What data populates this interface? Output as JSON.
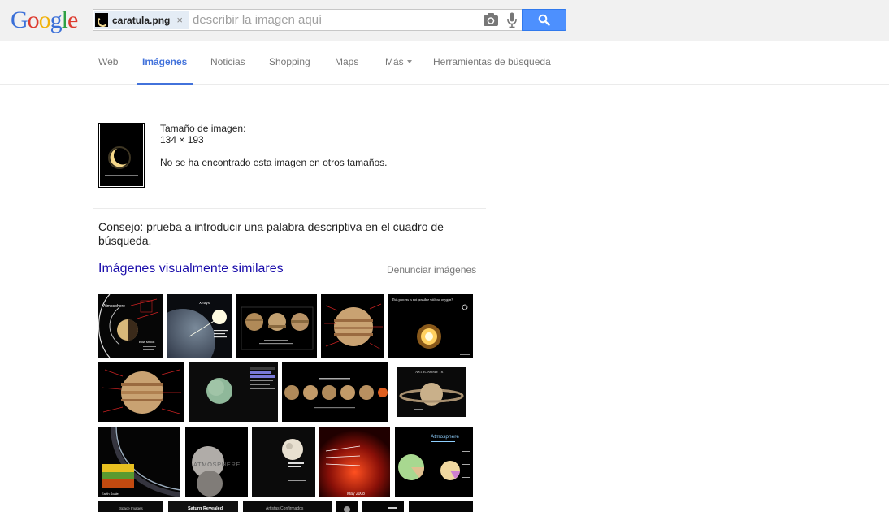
{
  "header": {
    "logo_letters": [
      {
        "ch": "G",
        "color": "#3a6fd8"
      },
      {
        "ch": "o",
        "color": "#dd3b2f"
      },
      {
        "ch": "o",
        "color": "#f1b20c"
      },
      {
        "ch": "g",
        "color": "#3a6fd8"
      },
      {
        "ch": "l",
        "color": "#2ea043"
      },
      {
        "ch": "e",
        "color": "#dd3b2f"
      }
    ],
    "image_chip": {
      "filename": "caratula.png",
      "remove": "×"
    },
    "search": {
      "placeholder": "describir la imagen aquí",
      "value": ""
    },
    "icons": {
      "camera": "camera-icon",
      "mic": "microphone-icon",
      "search": "search-icon"
    },
    "accent_color": "#4d90fe"
  },
  "nav": {
    "tabs": [
      {
        "label": "Web",
        "active": false
      },
      {
        "label": "Imágenes",
        "active": true
      },
      {
        "label": "Noticias",
        "active": false
      },
      {
        "label": "Shopping",
        "active": false
      },
      {
        "label": "Maps",
        "active": false
      },
      {
        "label": "Más",
        "active": false,
        "dropdown": true
      },
      {
        "label": "Herramientas de búsqueda",
        "active": false
      }
    ]
  },
  "result": {
    "size_label": "Tamaño de imagen:",
    "size_value": "134 × 193",
    "not_found": "No se ha encontrado esta imagen en otros tamaños.",
    "tip": "Consejo: prueba a introducir una palabra descriptiva en el cuadro de búsqueda.",
    "similar_title": "Imágenes visualmente similares",
    "report_label": "Denunciar imágenes"
  },
  "similar_images": {
    "row1": [
      {
        "kind": "atmosphere-diagram",
        "text": [
          "Atmosphere",
          "Bow shock"
        ]
      },
      {
        "kind": "planet-xray",
        "text": [
          "X-rays"
        ]
      },
      {
        "kind": "three-planets",
        "text": []
      },
      {
        "kind": "jupiter-labels",
        "text": []
      },
      {
        "kind": "explosion",
        "text": [
          "This process is not possible without oxygen?"
        ]
      }
    ],
    "row2": [
      {
        "kind": "jupiter-labels-wide",
        "text": []
      },
      {
        "kind": "green-planet",
        "text": []
      },
      {
        "kind": "five-planets",
        "text": []
      },
      {
        "kind": "saturn",
        "text": [
          "ASTRONOMY 161"
        ]
      }
    ],
    "row3": [
      {
        "kind": "limb-layers",
        "text": []
      },
      {
        "kind": "moon-atmosphere",
        "text": [
          "ATMOSPHERE"
        ]
      },
      {
        "kind": "moon-night",
        "text": []
      },
      {
        "kind": "red-glow",
        "text": [
          "May 2008"
        ]
      },
      {
        "kind": "pie-charts",
        "text": [
          "Atmosphere"
        ]
      }
    ],
    "row4": [
      {
        "kind": "dark-strip",
        "text": [
          "Space Images"
        ]
      },
      {
        "kind": "dark-strip",
        "text": [
          "Saturn Revealed"
        ]
      },
      {
        "kind": "dark-strip",
        "text": [
          "Artistas Confirmados"
        ]
      },
      {
        "kind": "dark-strip",
        "text": [
          ""
        ]
      },
      {
        "kind": "dark-strip",
        "text": [
          ""
        ]
      },
      {
        "kind": "dark-strip",
        "text": [
          ""
        ]
      }
    ]
  }
}
